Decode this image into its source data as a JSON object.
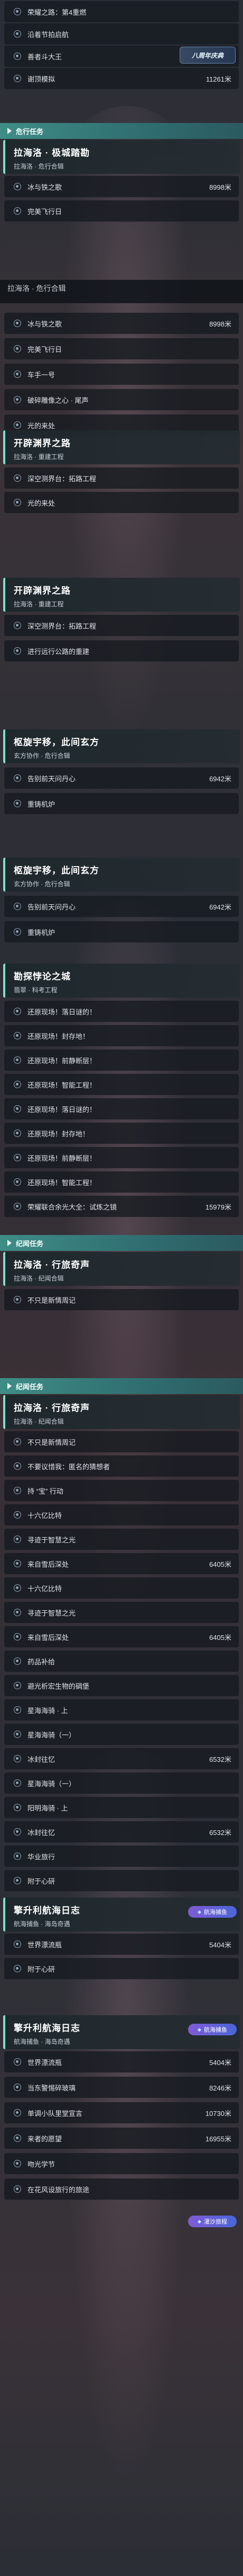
{
  "colors": {
    "accent": "#7ee0c8",
    "section": "#3f8d87",
    "badge": "#7e5bd6"
  },
  "top_list": [
    {
      "label": "荣耀之路：第4重燃",
      "dist": ""
    },
    {
      "label": "沿着节拍启航",
      "dist": ""
    },
    {
      "label": "善者斗大王",
      "dist": ""
    },
    {
      "label": "谢顶模拟",
      "dist": "11261米"
    }
  ],
  "corner_badge": "八周年庆典",
  "sec1_title": "危行任务",
  "card1": {
    "title": "拉海洛 · 极城踏勘",
    "sub": "拉海洛 · 危行合辑"
  },
  "list1": [
    {
      "label": "冰与铁之歌",
      "dist": "8998米"
    },
    {
      "label": "完美飞行日",
      "dist": ""
    }
  ],
  "sub1": "拉海洛 · 危行合辑",
  "list2": [
    {
      "label": "冰与铁之歌",
      "dist": "8998米"
    },
    {
      "label": "完美飞行日",
      "dist": ""
    },
    {
      "label": "车手一号",
      "dist": ""
    },
    {
      "label": "破碎雕像之心 · 尾声",
      "dist": ""
    },
    {
      "label": "光的来处",
      "dist": ""
    }
  ],
  "card2": {
    "title": "开辟渊界之路",
    "sub": "拉海洛 · 重建工程"
  },
  "list3": [
    {
      "label": "深空测界台：拓路工程",
      "dist": ""
    },
    {
      "label": "光的来处",
      "dist": ""
    }
  ],
  "card3": {
    "title": "开辟渊界之路",
    "sub": "拉海洛 · 重建工程"
  },
  "list4": [
    {
      "label": "深空测界台：拓路工程",
      "dist": ""
    },
    {
      "label": "进行远行公路的重建",
      "dist": ""
    }
  ],
  "card4": {
    "title": "枢旋宇移，此间玄方",
    "sub": "玄方协作 · 危行合辑"
  },
  "list5": [
    {
      "label": "告别前天问丹心",
      "dist": "6942米"
    },
    {
      "label": "重铸机炉",
      "dist": ""
    }
  ],
  "card5": {
    "title": "枢旋宇移，此间玄方",
    "sub": "玄方协作 · 危行合辑"
  },
  "list6": [
    {
      "label": "告别前天问丹心",
      "dist": "6942米"
    },
    {
      "label": "重铸机炉",
      "dist": ""
    }
  ],
  "card6": {
    "title": "勘探悖论之城",
    "sub": "翡翠 · 科考工程"
  },
  "list7": [
    {
      "label": "还原现场！落日谜的！",
      "dist": ""
    },
    {
      "label": "还原现场！封存地！",
      "dist": ""
    },
    {
      "label": "还原现场！前静断层！",
      "dist": ""
    },
    {
      "label": "还原现场！智能工程！",
      "dist": ""
    },
    {
      "label": "还原现场！落日谜的！",
      "dist": ""
    },
    {
      "label": "还原现场！封存地！",
      "dist": ""
    },
    {
      "label": "还原现场！前静断层！",
      "dist": ""
    },
    {
      "label": "还原现场！智能工程！",
      "dist": ""
    },
    {
      "label": "荣耀联合余光大全：试炼之镜",
      "dist": "15979米"
    }
  ],
  "sec2_title": "纪闻任务",
  "card7": {
    "title": "拉海洛 · 行旅奇声",
    "sub": "拉海洛 · 纪闻合辑"
  },
  "list8": [
    {
      "label": "不只是新情周记",
      "dist": ""
    }
  ],
  "sec3_title": "纪闻任务",
  "card8": {
    "title": "拉海洛 · 行旅奇声",
    "sub": "拉海洛 · 纪闻合辑"
  },
  "list9": [
    {
      "label": "不只是新情周记",
      "dist": ""
    },
    {
      "label": "不要议惜我：匿名的猜想者",
      "dist": ""
    },
    {
      "label": "持 “宝” 行动",
      "dist": ""
    },
    {
      "label": "十六亿比特",
      "dist": ""
    },
    {
      "label": "寻迹于智慧之光",
      "dist": ""
    },
    {
      "label": "来自雪后深处",
      "dist": "6405米"
    },
    {
      "label": "十六亿比特",
      "dist": ""
    },
    {
      "label": "寻迹于智慧之光",
      "dist": ""
    },
    {
      "label": "来自雪后深处",
      "dist": "6405米"
    },
    {
      "label": "药品补给",
      "dist": ""
    },
    {
      "label": "避光析宏生物的碉堡",
      "dist": ""
    },
    {
      "label": "星海海骑 · 上",
      "dist": ""
    },
    {
      "label": "星海海骑（一）",
      "dist": ""
    },
    {
      "label": "冰封往忆",
      "dist": "6532米"
    },
    {
      "label": "星海海骑（一）",
      "dist": ""
    },
    {
      "label": "阳明海骑 · 上",
      "dist": ""
    },
    {
      "label": "冰封往忆",
      "dist": "6532米"
    },
    {
      "label": "华业旅行",
      "dist": ""
    },
    {
      "label": "附于心研",
      "dist": ""
    }
  ],
  "card9": {
    "title": "擎升利航海日志",
    "sub": "航海捕鱼 · 海岛奇遇"
  },
  "nav1": "航海捕鱼",
  "list10": [
    {
      "label": "世界漂流瓶",
      "dist": "5404米"
    },
    {
      "label": "附于心研",
      "dist": ""
    }
  ],
  "card10": {
    "title": "擎升利航海日志",
    "sub": "航海捕鱼 · 海岛奇遇"
  },
  "nav2": "航海捕鱼",
  "list11": [
    {
      "label": "世界漂流瓶",
      "dist": "5404米"
    },
    {
      "label": "当东警惕碎玻璃",
      "dist": "8246米"
    },
    {
      "label": "单调小队里堂宣言",
      "dist": "10730米"
    },
    {
      "label": "来者的愿望",
      "dist": "16955米"
    },
    {
      "label": "吻光学节",
      "dist": ""
    },
    {
      "label": "在花风设旅行的旅途",
      "dist": ""
    }
  ],
  "nav3": "灌沙旅程"
}
